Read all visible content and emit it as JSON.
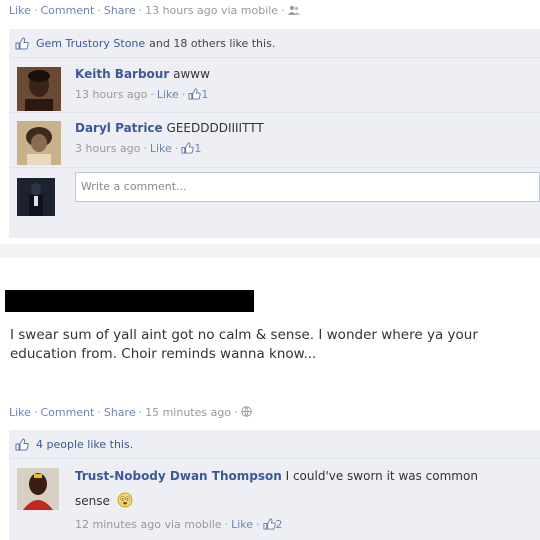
{
  "post1": {
    "actions": {
      "like": "Like",
      "comment": "Comment",
      "share": "Share",
      "time": "13 hours ago via mobile",
      "sep": "·"
    },
    "likes": {
      "names": "Gem Trustory Stone",
      "rest": "and 18 others like this."
    },
    "comments": [
      {
        "author": "Keith Barbour",
        "text": "awww",
        "time": "13 hours ago",
        "like": "Like",
        "count": "1"
      },
      {
        "author": "Daryl Patrice",
        "text": "GEEDDDDIIIITTT",
        "time": "3 hours ago",
        "like": "Like",
        "count": "1"
      }
    ],
    "write_placeholder": "Write a comment..."
  },
  "post2": {
    "status_text": "I swear sum of yall aint got no calm & sense. I wonder where ya your education from. Choir reminds wanna know...",
    "actions": {
      "like": "Like",
      "comment": "Comment",
      "share": "Share",
      "time": "15 minutes ago",
      "sep": "·"
    },
    "likes": {
      "text": "4 people like this."
    },
    "comments": [
      {
        "author": "Trust-Nobody Dwan Thompson",
        "text_line1": "I could've sworn it was common",
        "text_line2": "sense",
        "time": "12 minutes ago via mobile",
        "like": "Like",
        "count": "2"
      }
    ]
  },
  "colors": {
    "link": "#6d84b4",
    "author": "#3b5998",
    "panel": "#edeff4",
    "redaction": "#000000"
  },
  "icons": [
    "thumbs-up-icon",
    "people-icon",
    "globe-icon",
    "emoji-icon"
  ]
}
